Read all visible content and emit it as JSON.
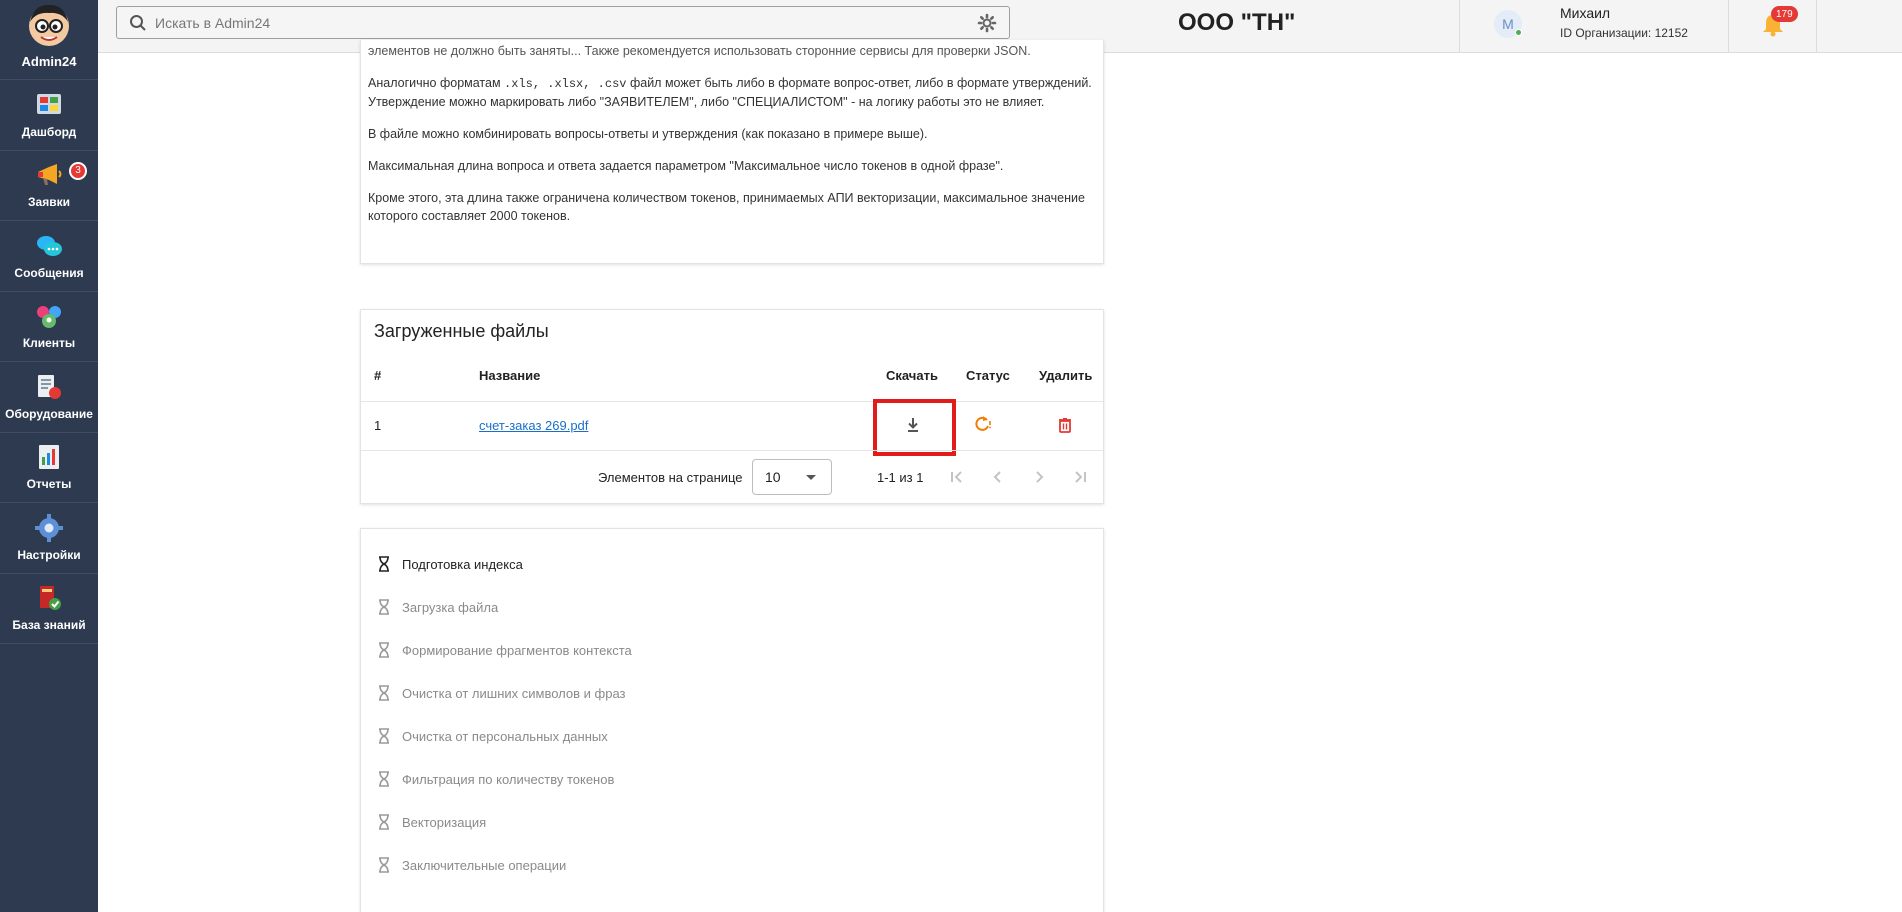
{
  "sidebar": {
    "brand": "Admin24",
    "items": [
      {
        "label": "Дашборд",
        "icon": "dashboard-icon"
      },
      {
        "label": "Заявки",
        "icon": "megaphone-icon",
        "badge": "3"
      },
      {
        "label": "Сообщения",
        "icon": "chat-bubbles-icon"
      },
      {
        "label": "Клиенты",
        "icon": "clients-icon"
      },
      {
        "label": "Оборудование",
        "icon": "equipment-icon"
      },
      {
        "label": "Отчеты",
        "icon": "report-icon"
      },
      {
        "label": "Настройки",
        "icon": "settings-gear-icon"
      },
      {
        "label": "База знаний",
        "icon": "knowledge-base-icon"
      }
    ]
  },
  "header": {
    "search_placeholder": "Искать в Admin24",
    "org_title": "ООО \"ТН\"",
    "user": {
      "initial": "М",
      "name": "Михаил",
      "org_id": "ID Организации: 12152"
    },
    "notifications_count": "179"
  },
  "doc": {
    "cut_line": "элементов не должно быть заняты...  Также рекомендуется использовать сторонние сервисы для проверки JSON.",
    "p1_a": "Аналогично форматам",
    "p1_code": ".xls, .xlsx, .csv",
    "p1_b": "файл может быть либо в формате вопрос-ответ, либо в формате утверждений. Утверждение можно маркировать либо \"ЗАЯВИТЕЛЕМ\", либо \"СПЕЦИАЛИСТОМ\" - на логику работы это не влияет.",
    "p2": "В файле можно комбинировать вопросы-ответы и утверждения (как показано в примере выше).",
    "p3": "Максимальная длина вопроса и ответа задается параметром \"Максимальное число токенов в одной фразе\".",
    "p4": "Кроме этого, эта длина также ограничена количеством токенов, принимаемых АПИ векторизации, максимальное значение которого составляет 2000 токенов."
  },
  "files": {
    "title": "Загруженные файлы",
    "columns": {
      "num": "#",
      "name": "Название",
      "download": "Скачать",
      "status": "Статус",
      "delete": "Удалить"
    },
    "rows": [
      {
        "num": "1",
        "name": "счет-заказ 269.pdf"
      }
    ],
    "pager": {
      "label": "Элементов на странице",
      "page_size": "10",
      "range": "1-1 из 1"
    }
  },
  "steps": {
    "items": [
      {
        "label": "Подготовка индекса",
        "active": true
      },
      {
        "label": "Загрузка файла",
        "active": false
      },
      {
        "label": "Формирование фрагментов контекста",
        "active": false
      },
      {
        "label": "Очистка от лишних символов и фраз",
        "active": false
      },
      {
        "label": "Очистка от персональных данных",
        "active": false
      },
      {
        "label": "Фильтрация по количеству токенов",
        "active": false
      },
      {
        "label": "Векторизация",
        "active": false
      },
      {
        "label": "Заключительные операции",
        "active": false
      }
    ]
  },
  "colors": {
    "sidebar_bg": "#2d3a50",
    "highlight": "#e21b1b",
    "link": "#1a6fc9",
    "status_orange": "#f57c00",
    "delete_red": "#e53935"
  }
}
